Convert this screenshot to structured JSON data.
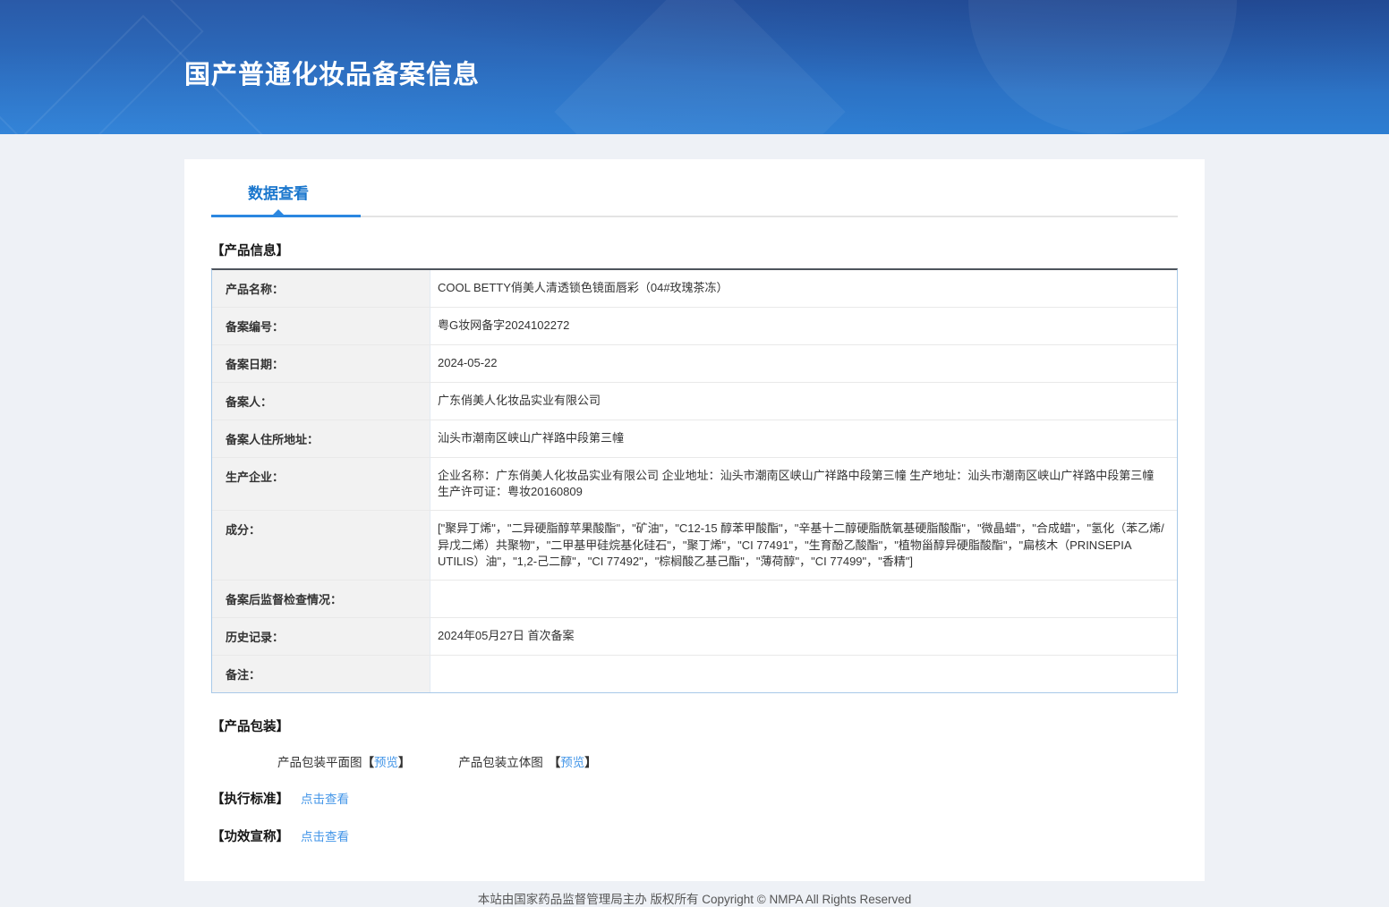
{
  "colors": {
    "header_gradient_top": "#2a5aa8",
    "header_gradient_bottom": "#2d7ed2",
    "tab_accent_blue": "#2b87e0",
    "link_blue": "#4496e8",
    "table_border_blue": "#a8c9e8",
    "label_cell_bg": "#f2f2f2"
  },
  "header": {
    "title": "国产普通化妆品备案信息"
  },
  "tabs": {
    "data_view": "数据查看"
  },
  "product_info": {
    "section_title": "【产品信息】",
    "rows": [
      {
        "label": "产品名称：",
        "value": "COOL BETTY俏美人清透锁色镜面唇彩（04#玫瑰茶冻）"
      },
      {
        "label": "备案编号：",
        "value": "粤G妆网备字2024102272"
      },
      {
        "label": "备案日期：",
        "value": "2024-05-22"
      },
      {
        "label": "备案人：",
        "value": "广东俏美人化妆品实业有限公司"
      },
      {
        "label": "备案人住所地址：",
        "value": "汕头市潮南区峡山广祥路中段第三幢"
      },
      {
        "label": "生产企业：",
        "value": "企业名称：广东俏美人化妆品实业有限公司 企业地址：汕头市潮南区峡山广祥路中段第三幢 生产地址：汕头市潮南区峡山广祥路中段第三幢 生产许可证：粤妆20160809"
      },
      {
        "label": "成分：",
        "value": "[\"聚异丁烯\"，\"二异硬脂醇苹果酸酯\"，\"矿油\"，\"C12-15 醇苯甲酸酯\"，\"辛基十二醇硬脂酰氧基硬脂酸酯\"，\"微晶蜡\"，\"合成蜡\"，\"氢化（苯乙烯/异戊二烯）共聚物\"，\"二甲基甲硅烷基化硅石\"，\"聚丁烯\"，\"CI 77491\"，\"生育酚乙酸酯\"，\"植物甾醇异硬脂酸酯\"，\"扁核木（PRINSEPIA UTILIS）油\"，\"1,2-己二醇\"，\"CI 77492\"，\"棕榈酸乙基己酯\"，\"薄荷醇\"，\"CI 77499\"，\"香精\"]"
      },
      {
        "label": "备案后监督检查情况：",
        "value": ""
      },
      {
        "label": "历史记录：",
        "value": "2024年05月27日 首次备案"
      },
      {
        "label": "备注：",
        "value": ""
      }
    ]
  },
  "packaging": {
    "section_title": "【产品包装】",
    "flat_label": "产品包装平面图",
    "stereo_label": "产品包装立体图",
    "bracket_open": "【",
    "bracket_close": "】",
    "preview_link": "预览"
  },
  "standards": {
    "section_title": "【执行标准】",
    "link": "点击查看"
  },
  "efficacy": {
    "section_title": "【功效宣称】",
    "link": "点击查看"
  },
  "footer": {
    "copyright": "本站由国家药品监督管理局主办 版权所有 Copyright © NMPA All Rights Reserved"
  }
}
